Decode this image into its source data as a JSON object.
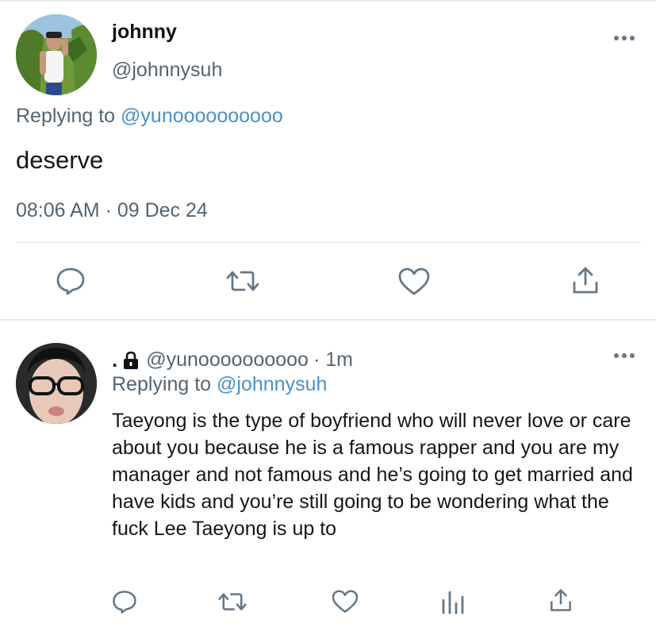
{
  "main_tweet": {
    "display_name": "johnny",
    "handle": "@johnnysuh",
    "replying_prefix": "Replying to ",
    "replying_to": "@yunoooooooooo",
    "text": "deserve",
    "timestamp": "08:06 AM · 09 Dec 24",
    "actions": [
      "reply-icon",
      "retweet-icon",
      "like-icon",
      "share-icon"
    ]
  },
  "reply_tweet": {
    "display_name": ".",
    "handle": "@yunoooooooooo",
    "time_ago": "· 1m",
    "replying_prefix": "Replying to ",
    "replying_to": "@johnnysuh",
    "text": "Taeyong is the type of boyfriend who will never love or care about you because he is a famous rapper and you are my manager and not famous and he’s going to get married and have kids and you’re still going to be wondering what the fuck Lee Taeyong is up to",
    "actions": [
      "reply-icon",
      "retweet-icon",
      "like-icon",
      "analytics-icon",
      "share-icon"
    ]
  },
  "colors": {
    "text_primary": "#0f1419",
    "text_secondary": "#536471",
    "mention": "#4a90c8",
    "divider": "#e1e4e8",
    "icon": "#657786"
  }
}
